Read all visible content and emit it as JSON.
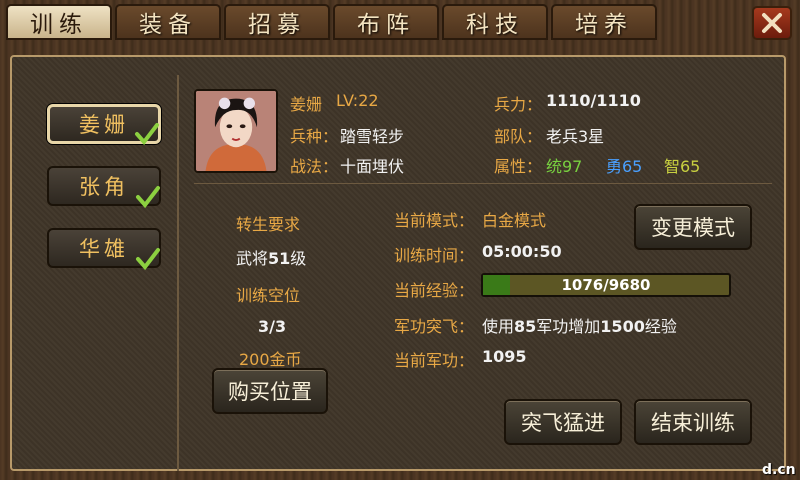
{
  "tabs": [
    "训练",
    "装备",
    "招募",
    "布阵",
    "科技",
    "培养"
  ],
  "active_tab": 0,
  "heroes": [
    {
      "name": "姜姗",
      "checked": true,
      "selected": true
    },
    {
      "name": "张角",
      "checked": true,
      "selected": false
    },
    {
      "name": "华雄",
      "checked": true,
      "selected": false
    }
  ],
  "general": {
    "name": "姜姗",
    "level": "LV:22",
    "troop_type_label": "兵种：",
    "troop_type": "踏雪轻步",
    "tactic_label": "战法：",
    "tactic": "十面埋伏",
    "strength_label": "兵力：",
    "strength": "1110/1110",
    "unit_label": "部队：",
    "unit": "老兵3星",
    "attr_label": "属性：",
    "attrs": [
      {
        "text": "统97",
        "color": "#78d040"
      },
      {
        "text": "勇65",
        "color": "#4aa0ff"
      },
      {
        "text": "智65",
        "color": "#c8d040"
      }
    ]
  },
  "rebirth": {
    "title": "转生要求",
    "requirement_prefix": "武将",
    "requirement_level": "51",
    "requirement_suffix": "级",
    "slots_title": "训练空位",
    "slots": "3/3",
    "cost": "200金币",
    "buy_label": "购买位置"
  },
  "training": {
    "mode_label": "当前模式：",
    "mode": "白金模式",
    "time_label": "训练时间：",
    "time": "05:00:50",
    "exp_label": "当前经验：",
    "exp_text": "1076/9680",
    "exp_fraction": 0.111,
    "breakthrough_label": "军功突飞：",
    "breakthrough_text_1": "使用",
    "breakthrough_merit": "85",
    "breakthrough_text_2": "军功增加",
    "breakthrough_exp": "1500",
    "breakthrough_text_3": "经验",
    "merit_label": "当前军功：",
    "merit": "1095",
    "change_mode_label": "变更模式",
    "breakthrough_button": "突飞猛进",
    "end_button": "结束训练"
  },
  "watermark": "d.cn"
}
